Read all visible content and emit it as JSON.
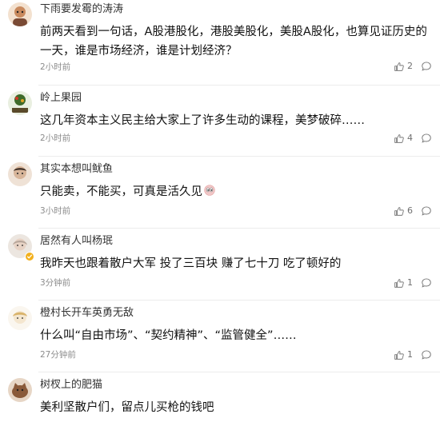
{
  "comments": [
    {
      "username": "下雨要发霉的涛涛",
      "text": "前两天看到一句话，A股港股化，港股美股化，美股A股化，也算见证历史的一天，谁是市场经济，谁是计划经济？",
      "time": "2小时前",
      "likes": "2",
      "avatar_color": "#c98a5e"
    },
    {
      "username": "岭上果园",
      "text": "这几年资本主义民主给大家上了许多生动的课程，美梦破碎……",
      "time": "2小时前",
      "likes": "4",
      "avatar_color": "#3f6b2a"
    },
    {
      "username": "其实本想叫鱿鱼",
      "text": "只能卖，不能买，可真是活久见",
      "emoji": "eyes-emoji",
      "time": "3小时前",
      "likes": "6",
      "avatar_color": "#d7b59a"
    },
    {
      "username": "居然有人叫杨珉",
      "text": "我昨天也跟着散户大军 投了三百块 赚了七十刀 吃了顿好的",
      "time": "3分钟前",
      "likes": "1",
      "avatar_color": "#b7a69a",
      "verified": true
    },
    {
      "username": "橙村长开车英勇无敌",
      "text": "什么叫“自由市场”、“契约精神”、“监管健全”……",
      "time": "27分钟前",
      "likes": "1",
      "avatar_color": "#e8dcc8"
    },
    {
      "username": "树杈上的肥猫",
      "text": "美利坚散户们，留点儿买枪的钱吧",
      "time": "",
      "likes": "",
      "avatar_color": "#8a5a3a"
    }
  ],
  "colors": {
    "text": "#111111",
    "meta": "#8c8c8c",
    "divider": "#ececec",
    "verified_badge": "#f2b01e"
  }
}
